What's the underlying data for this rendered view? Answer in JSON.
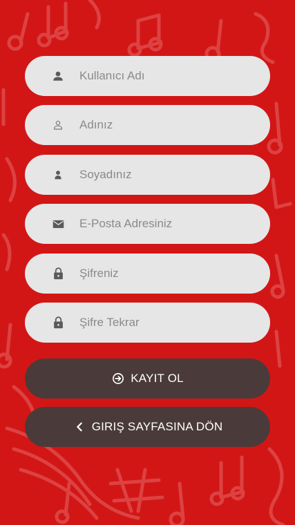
{
  "theme": {
    "background": "#d21616",
    "field_background": "#e6e6e6",
    "button_background": "#4a3b3a",
    "placeholder_color": "#8a8a8a",
    "icon_color": "#5a5a5a"
  },
  "form": {
    "fields": [
      {
        "placeholder": "Kullanıcı Adı",
        "icon": "person-icon",
        "type": "text"
      },
      {
        "placeholder": "Adınız",
        "icon": "person-outline-icon",
        "type": "text"
      },
      {
        "placeholder": "Soyadınız",
        "icon": "person-small-icon",
        "type": "text"
      },
      {
        "placeholder": "E-Posta Adresiniz",
        "icon": "mail-icon",
        "type": "email"
      },
      {
        "placeholder": "Şifreniz",
        "icon": "lock-icon",
        "type": "password"
      },
      {
        "placeholder": "Şifre Tekrar",
        "icon": "lock-icon",
        "type": "password"
      }
    ]
  },
  "buttons": {
    "register_label": "KAYIT OL",
    "register_icon": "login-arrow-icon",
    "back_label": "GIRIŞ SAYFASINA DÖN",
    "back_icon": "chevron-left-icon"
  }
}
